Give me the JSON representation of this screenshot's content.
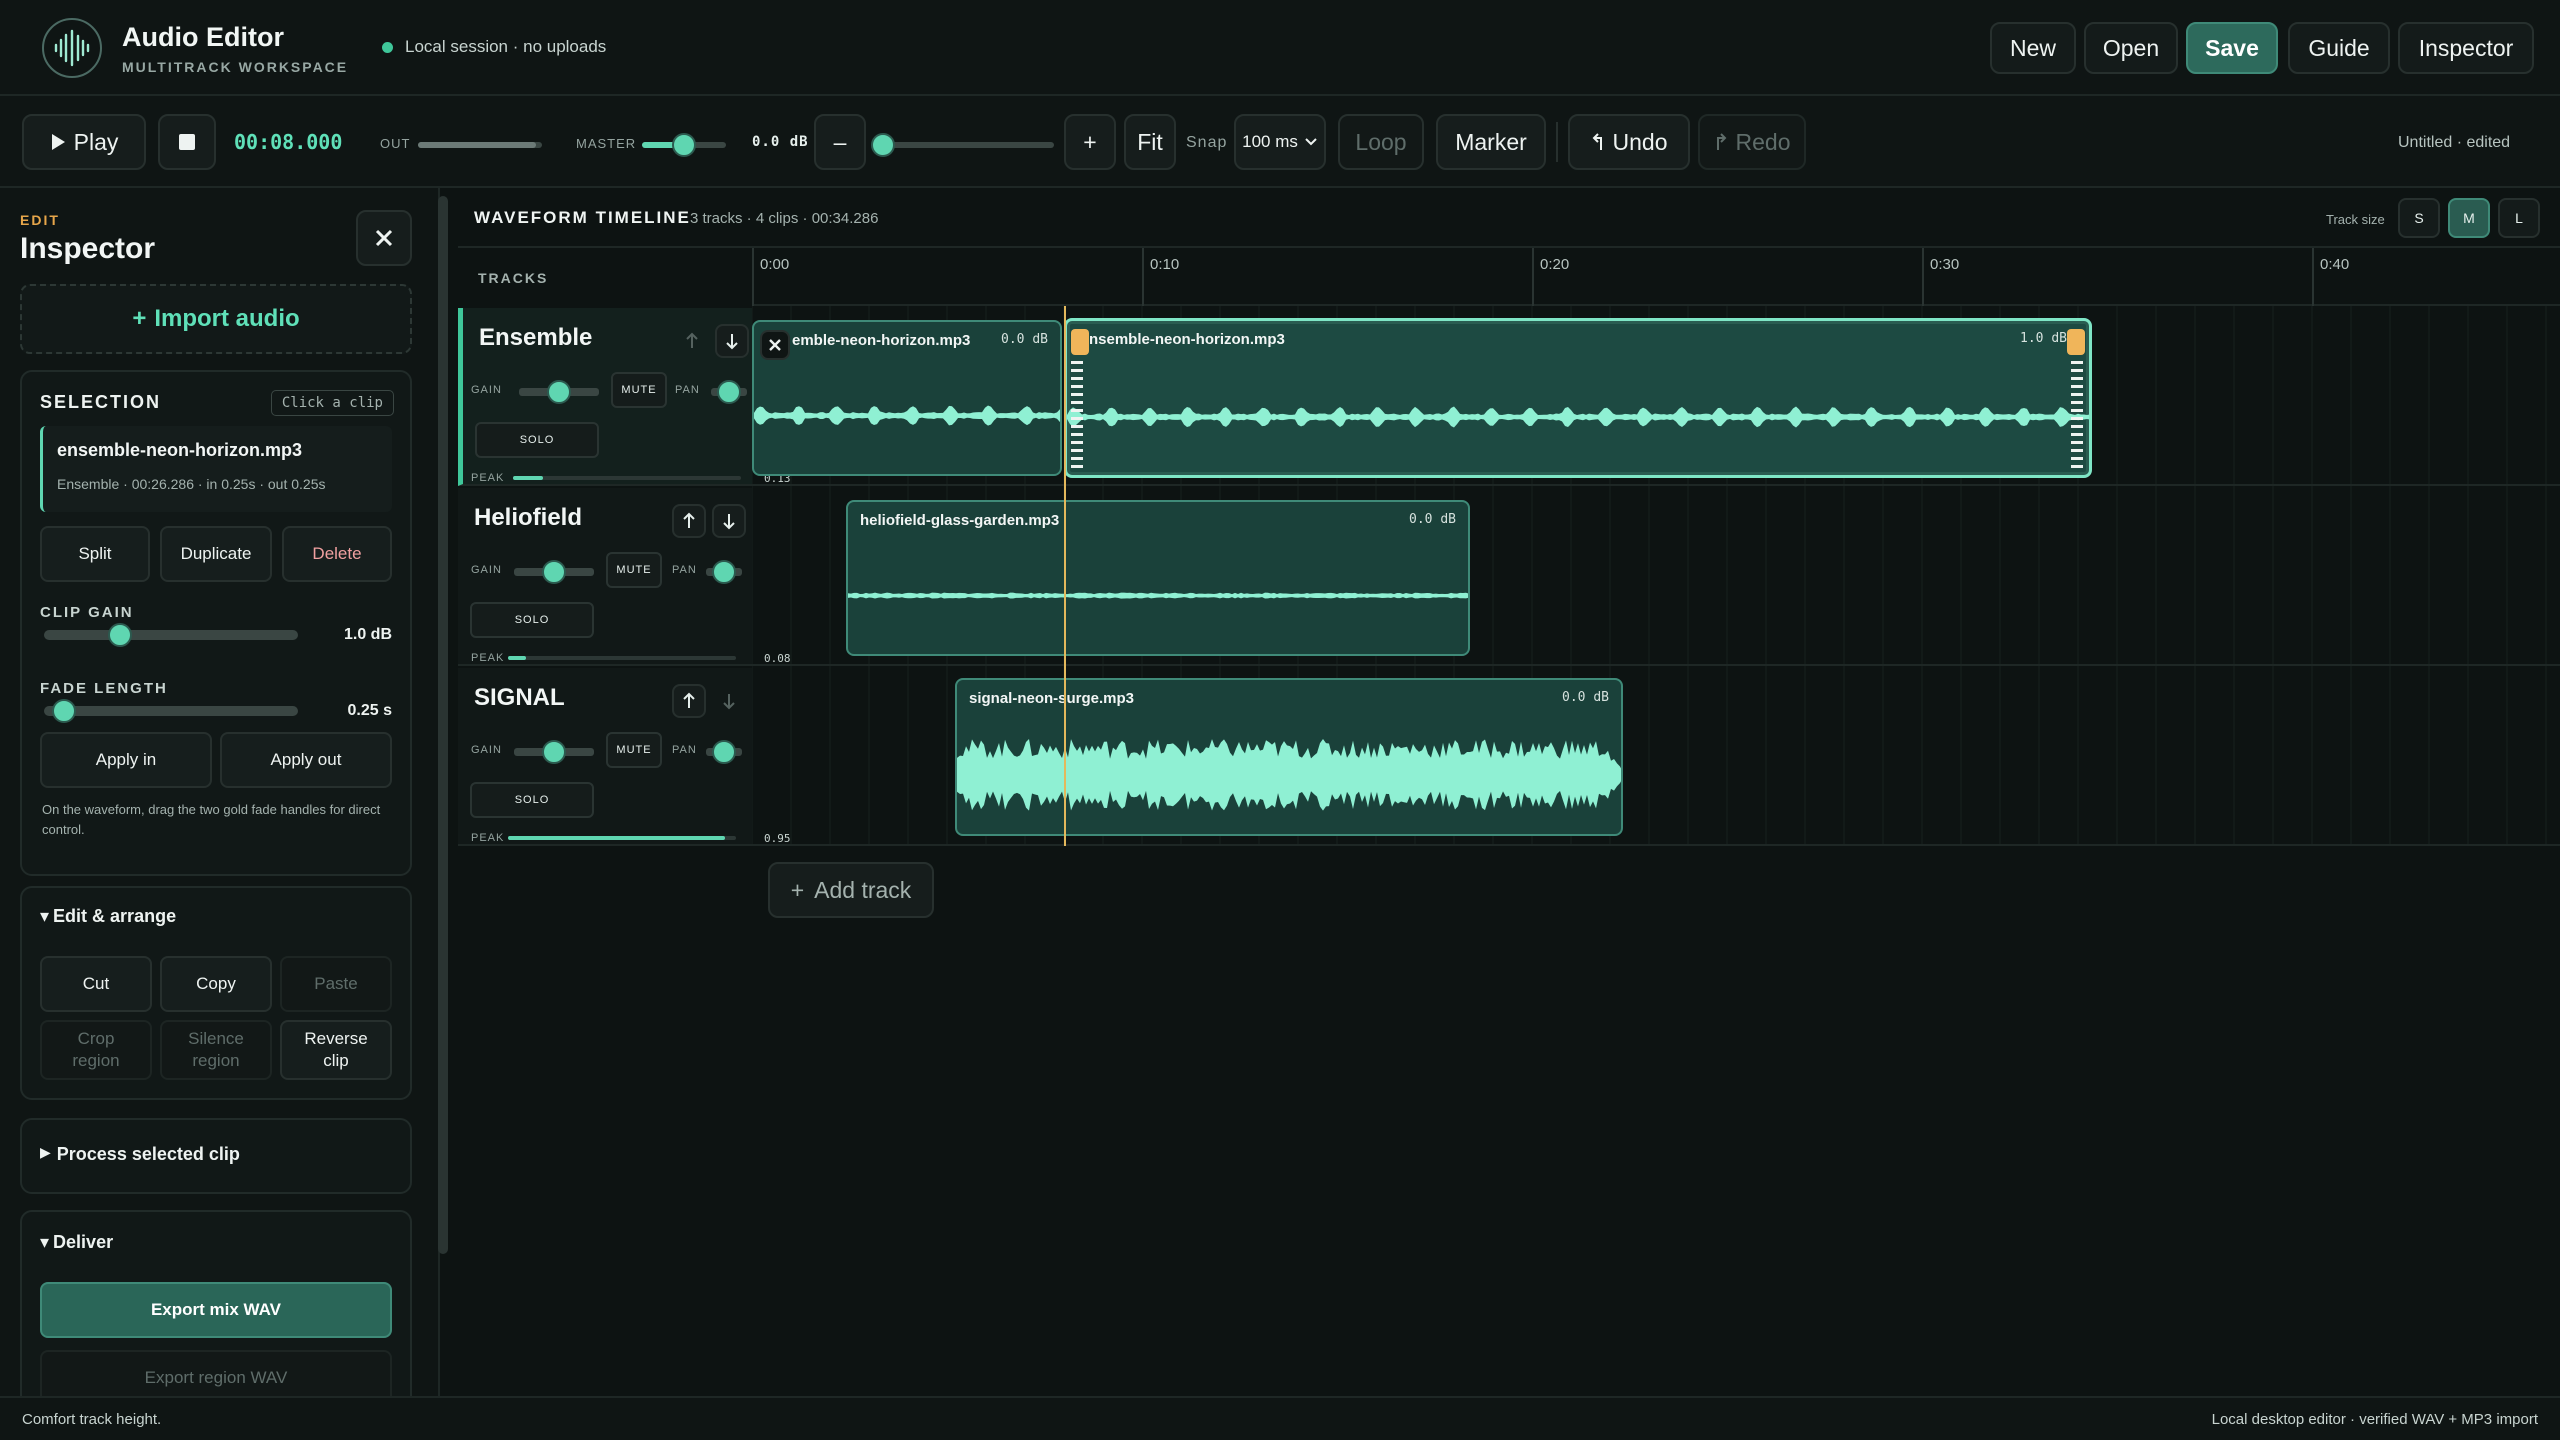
{
  "header": {
    "title": "Audio Editor",
    "subtitle": "MULTITRACK WORKSPACE",
    "session": "Local session · no uploads",
    "buttons": {
      "new": "New",
      "open": "Open",
      "save": "Save",
      "guide": "Guide",
      "inspector": "Inspector"
    }
  },
  "transport": {
    "play": "Play",
    "time": "00:08.000",
    "out_label": "OUT",
    "master_label": "MASTER",
    "master_db": "0.0 dB",
    "out_level": 0.95,
    "master_level": 0.5,
    "zoom_level": 0.02,
    "zoom_out": "–",
    "zoom_in": "+",
    "fit": "Fit",
    "snap_label": "Snap",
    "snap_value": "100 ms",
    "loop": "Loop",
    "marker": "Marker",
    "undo": "Undo",
    "redo": "Redo",
    "doc_status": "Untitled · edited"
  },
  "sidebar": {
    "tag": "EDIT",
    "title": "Inspector",
    "import": "Import audio",
    "selection": {
      "title": "SELECTION",
      "hint": "Click a clip",
      "clip_name": "ensemble-neon-horizon.mp3",
      "clip_meta": "Ensemble · 00:26.286 · in 0.25s · out 0.25s",
      "split": "Split",
      "duplicate": "Duplicate",
      "delete": "Delete",
      "clip_gain_label": "CLIP GAIN",
      "clip_gain_value": "1.0 dB",
      "clip_gain_level": 0.3,
      "fade_label": "FADE LENGTH",
      "fade_value": "0.25 s",
      "fade_level": 0.08,
      "apply_in": "Apply in",
      "apply_out": "Apply out",
      "help": "On the waveform, drag the two gold fade handles for direct control."
    },
    "edit_arrange": {
      "title": "Edit & arrange",
      "cut": "Cut",
      "copy": "Copy",
      "paste": "Paste",
      "crop": "Crop region",
      "silence": "Silence region",
      "reverse": "Reverse clip"
    },
    "process": {
      "title": "Process selected clip"
    },
    "deliver": {
      "title": "Deliver",
      "export_mix": "Export mix WAV",
      "export_region": "Export region WAV"
    }
  },
  "timeline": {
    "title": "WAVEFORM TIMELINE",
    "meta": "3 tracks · 4 clips · 00:34.286",
    "track_size_label": "Track size",
    "sizes": [
      "S",
      "M",
      "L"
    ],
    "tracks_label": "TRACKS",
    "ruler": [
      "0:00",
      "0:10",
      "0:20",
      "0:30",
      "0:40"
    ],
    "add_track": "Add track"
  },
  "tracks": [
    {
      "name": "Ensemble",
      "gain_label": "GAIN",
      "pan_label": "PAN",
      "mute": "MUTE",
      "solo": "SOLO",
      "peak_label": "PEAK",
      "peak_value": "0.13",
      "peak_level": 0.13,
      "gain_level": 0.5,
      "pan_level": 0.5,
      "clips": [
        {
          "name": "emble-neon-horizon.mp3",
          "db": "0.0 dB"
        },
        {
          "name": "nsemble-neon-horizon.mp3",
          "db": "1.0 dB"
        }
      ]
    },
    {
      "name": "Heliofield",
      "gain_label": "GAIN",
      "pan_label": "PAN",
      "mute": "MUTE",
      "solo": "SOLO",
      "peak_label": "PEAK",
      "peak_value": "0.08",
      "peak_level": 0.08,
      "gain_level": 0.5,
      "pan_level": 0.5,
      "clips": [
        {
          "name": "heliofield-glass-garden.mp3",
          "db": "0.0 dB"
        }
      ]
    },
    {
      "name": "SIGNAL",
      "gain_label": "GAIN",
      "pan_label": "PAN",
      "mute": "MUTE",
      "solo": "SOLO",
      "peak_label": "PEAK",
      "peak_value": "0.95",
      "peak_level": 0.95,
      "gain_level": 0.5,
      "pan_level": 0.5,
      "clips": [
        {
          "name": "signal-neon-surge.mp3",
          "db": "0.0 dB"
        }
      ]
    }
  ],
  "status": {
    "left": "Comfort track height.",
    "right": "Local desktop editor · verified WAV + MP3 import"
  },
  "colors": {
    "accent": "#5fd6b1",
    "fade_handle": "#f0b55a",
    "playhead": "#e3b85c",
    "primary_button": "#2d6a5c"
  }
}
